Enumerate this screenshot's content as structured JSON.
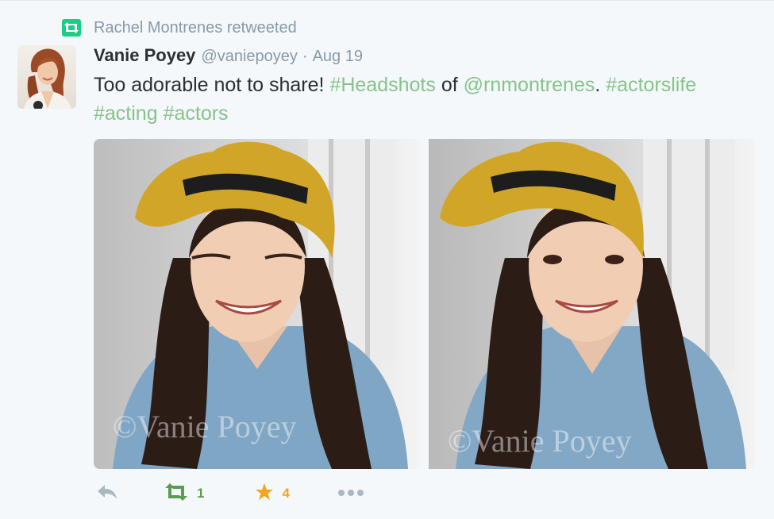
{
  "colors": {
    "retweet_green": "#19cf86",
    "retweet_action": "#5b9d4f",
    "favorite_gold": "#f4a420",
    "hashtag": "#86c38a",
    "muted_text": "#8899a6",
    "body_text": "#292f33"
  },
  "context": {
    "icon": "retweet-icon",
    "text": "Rachel Montrenes retweeted"
  },
  "tweet": {
    "fullname": "Vanie Poyey",
    "screen_name": "@vaniepoyey",
    "separator": "·",
    "timestamp": "Aug 19",
    "text_parts": {
      "p1": "Too adorable not to share! ",
      "hashtag1": "#Headshots",
      "p2": " of ",
      "mention": "@rnmontrenes",
      "p3": ". ",
      "hashtag2": "#actorslife",
      "p4": " ",
      "hashtag3": "#acting",
      "p5": " ",
      "hashtag4": "#actors"
    },
    "photos": [
      {
        "watermark": "©Vanie Poyey"
      },
      {
        "watermark": "©Vanie Poyey"
      }
    ]
  },
  "actions": {
    "reply": {
      "icon": "reply-icon"
    },
    "retweet": {
      "icon": "retweet-icon",
      "count": "1"
    },
    "favorite": {
      "icon": "star-icon",
      "count": "4"
    },
    "more": {
      "icon": "more-dots-icon"
    }
  }
}
